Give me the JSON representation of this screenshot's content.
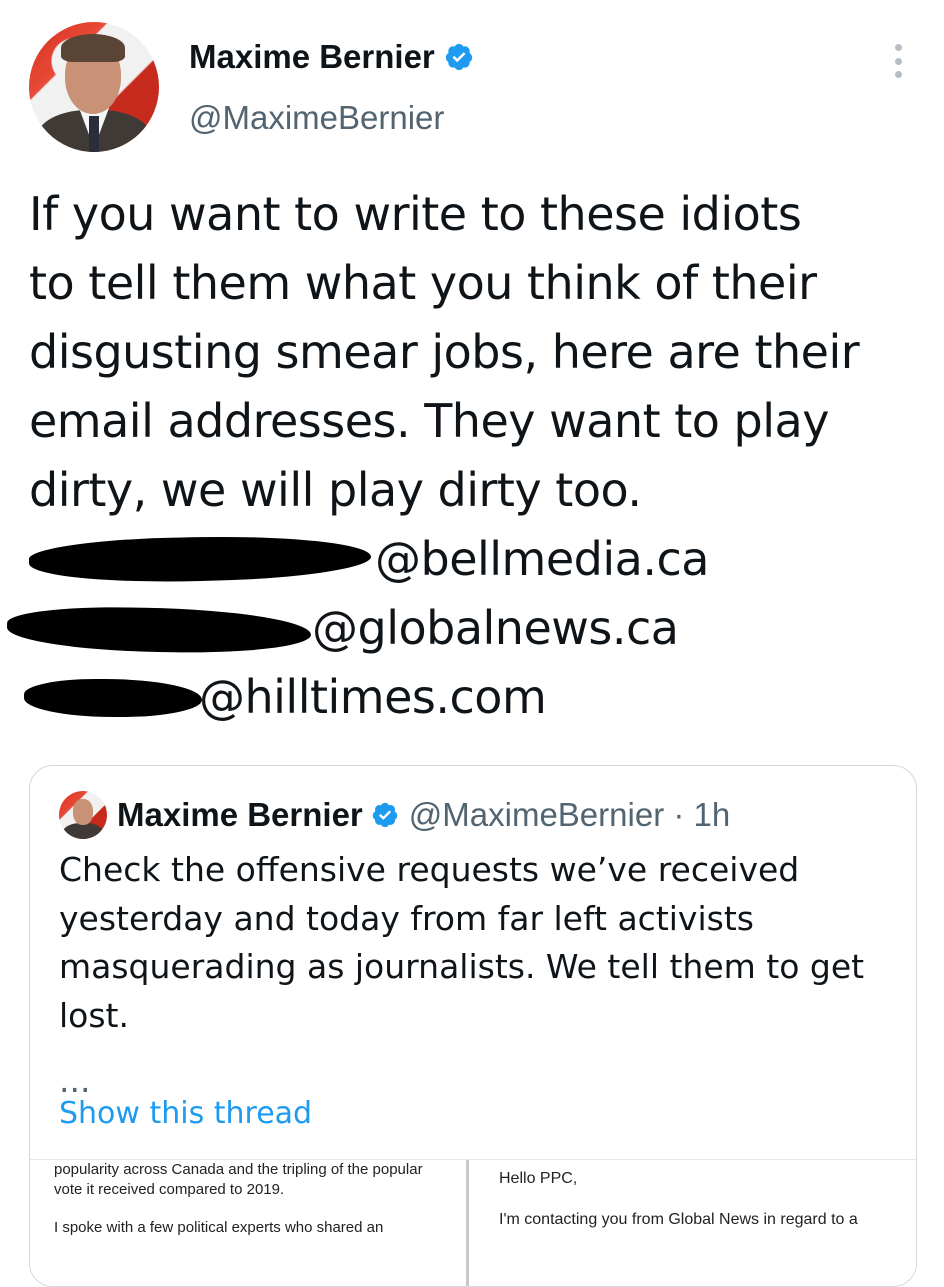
{
  "author": {
    "name": "Maxime Bernier",
    "handle": "@MaximeBernier"
  },
  "tweet": {
    "lines": [
      "If you want to write to these idiots",
      "to tell them what you think of their",
      "disgusting smear jobs, here are their",
      "email addresses. They want to play",
      "dirty, we will play dirty too."
    ],
    "emails": [
      "@bellmedia.ca",
      "@globalnews.ca",
      "@hilltimes.com"
    ]
  },
  "quoted": {
    "name": "Maxime Bernier",
    "handle": "@MaximeBernier · 1h",
    "text": "Check the offensive requests we’ve received yesterday and today from far left activists masquerading as journalists. We tell them to get lost.",
    "ellipsis": "...",
    "show_thread": "Show this thread",
    "image_left": {
      "line1": "popularity across Canada and the tripling of the popular",
      "line2": "vote it received compared to 2019.",
      "line3": "I spoke with a few political experts who shared an"
    },
    "image_right": {
      "line1": "Hello PPC,",
      "line2": "I'm contacting you from Global News in regard to a"
    }
  },
  "colors": {
    "verified": "#1d9bf0",
    "link": "#1d9bf0",
    "secondary": "#536471"
  }
}
